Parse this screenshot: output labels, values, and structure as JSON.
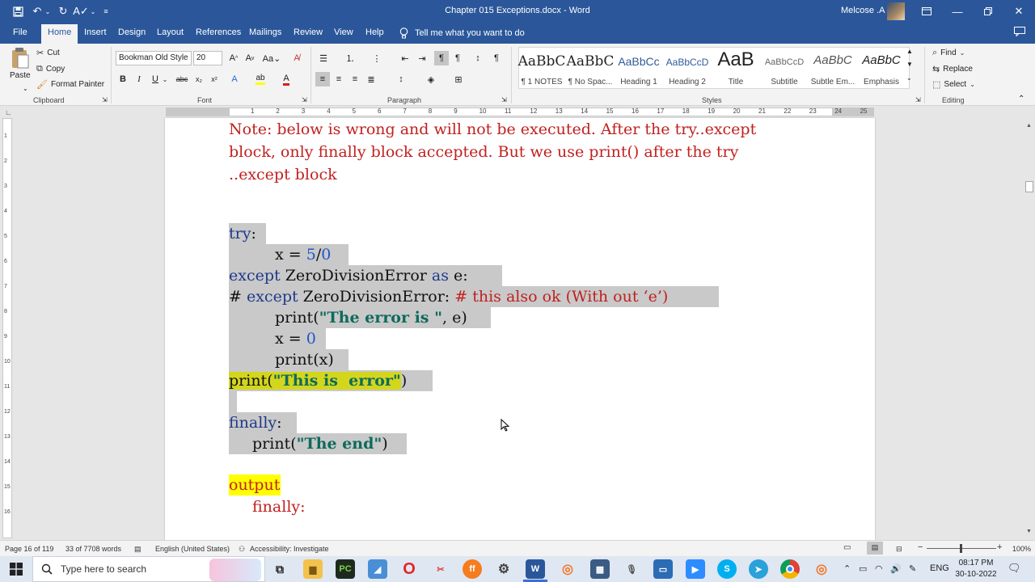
{
  "titlebar": {
    "doc_title": "Chapter 015 Exceptions.docx  -  Word",
    "user_name": "Melcose .A",
    "quick_access_icons": [
      "save-icon",
      "undo-icon",
      "redo-icon",
      "spelling-icon",
      "customize-icon"
    ]
  },
  "tabs": [
    {
      "label": "File",
      "active": false
    },
    {
      "label": "Home",
      "active": true
    },
    {
      "label": "Insert",
      "active": false
    },
    {
      "label": "Design",
      "active": false
    },
    {
      "label": "Layout",
      "active": false
    },
    {
      "label": "References",
      "active": false
    },
    {
      "label": "Mailings",
      "active": false
    },
    {
      "label": "Review",
      "active": false
    },
    {
      "label": "View",
      "active": false
    },
    {
      "label": "Help",
      "active": false
    }
  ],
  "tell_me": "Tell me what you want to do",
  "clipboard": {
    "paste": "Paste",
    "cut": "Cut",
    "copy": "Copy",
    "format_painter": "Format Painter",
    "group_label": "Clipboard"
  },
  "font": {
    "font_name": "Bookman Old Style",
    "font_size": "20",
    "group_label": "Font"
  },
  "paragraph": {
    "group_label": "Paragraph"
  },
  "styles": {
    "group_label": "Styles",
    "items": [
      {
        "sample": "AaBbC",
        "name": "¶ 1 NOTES"
      },
      {
        "sample": "AaBbC",
        "name": "¶ No Spac..."
      },
      {
        "sample": "AaBbCc",
        "name": "Heading 1"
      },
      {
        "sample": "AaBbCcD",
        "name": "Heading 2"
      },
      {
        "sample": "AaB",
        "name": "Title"
      },
      {
        "sample": "AaBbCcD",
        "name": "Subtitle"
      },
      {
        "sample": "AaBbC",
        "name": "Subtle Em..."
      },
      {
        "sample": "AaBbC",
        "name": "Emphasis"
      }
    ]
  },
  "editing": {
    "find": "Find",
    "replace": "Replace",
    "select": "Select",
    "group_label": "Editing"
  },
  "ruler_numbers": [
    "1",
    "2",
    "3",
    "4",
    "5",
    "6",
    "7",
    "8",
    "9",
    "10",
    "11",
    "12",
    "13",
    "14",
    "15",
    "16",
    "17",
    "18",
    "19",
    "20",
    "21",
    "22",
    "23",
    "24",
    "25"
  ],
  "vruler_numbers": [
    "1",
    "2",
    "3",
    "4",
    "5",
    "6",
    "7",
    "8",
    "9",
    "10",
    "11",
    "12",
    "13",
    "14",
    "15",
    "16"
  ],
  "document": {
    "note_lines": [
      "Note: below is wrong and will not be executed. After the try..except",
      "block, only finally block  accepted. But we use print() after the try",
      "..except block"
    ],
    "code": {
      "try_kw": "try",
      "colon": ":",
      "x_eq": "x = ",
      "five": "5",
      "slash": "/",
      "zero": "0",
      "except_kw": "except",
      "zde": " ZeroDivisionError ",
      "as_kw": "as",
      "e_colon": " e:",
      "hash": "# ",
      "except_kw2": "except",
      "zde2": " ZeroDivisionError: ",
      "comment": "# this also ok (With out ‘e’)",
      "print_open": "print(",
      "err_str": "\"The error is \"",
      "err_tail": ", e)",
      "x_eq2": "x = ",
      "zero2": "0",
      "print_x": "print(x)",
      "print_open2": "print(",
      "this_err": "\"This is  error\"",
      "close_paren": ")",
      "finally_kw": "finally",
      "colon2": ":",
      "print_open3": "print(",
      "the_end": "\"The end\"",
      "close_paren2": ")"
    },
    "output_label": "output",
    "output_finally": "finally:"
  },
  "statusbar": {
    "page": "Page 16 of 119",
    "words": "33 of 7708 words",
    "language": "English (United States)",
    "accessibility": "Accessibility: Investigate",
    "zoom": "100%"
  },
  "taskbar": {
    "search_placeholder": "Type here to search",
    "language": "ENG",
    "time": "08:17 PM",
    "date": "30-10-2022"
  },
  "colors": {
    "word_blue": "#2b579a",
    "note_red": "#c0211f",
    "code_keyword": "#1f3a8a",
    "code_string": "#0e6b5c",
    "selection_gray": "#c9c9c9",
    "highlight_yellow": "#ffff00"
  }
}
